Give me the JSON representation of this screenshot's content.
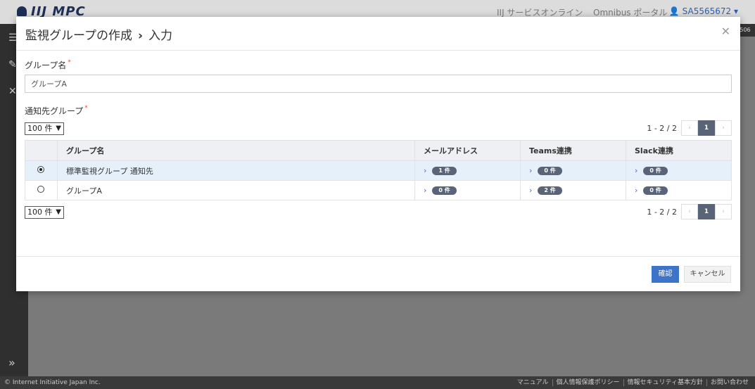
{
  "app": {
    "logo": "IIJ MPC",
    "nav_service": "IIJ サービスオンライン",
    "nav_portal": "Omnibus ポータル",
    "account": "SA5565672",
    "badge_fragment": "506"
  },
  "modal": {
    "title": "監視グループの作成",
    "title_step": "入力",
    "group_name_label": "グループ名",
    "group_name_value": "グループA",
    "notify_label": "通知先グループ",
    "per_page": "100 件",
    "range": "1 - 2 / 2",
    "current_page": "1",
    "columns": [
      "グループ名",
      "メールアドレス",
      "Teams連携",
      "Slack連携"
    ],
    "rows": [
      {
        "name": "標準監視グループ 通知先",
        "email": "1 件",
        "teams": "0 件",
        "slack": "0 件",
        "selected": true
      },
      {
        "name": "グループA",
        "email": "0 件",
        "teams": "2 件",
        "slack": "0 件",
        "selected": false
      }
    ],
    "confirm": "確認",
    "cancel": "キャンセル"
  },
  "footer": {
    "copyright": "© Internet Initiative Japan Inc.",
    "links": [
      "マニュアル",
      "個人情報保護ポリシー",
      "情報セキュリティ基本方針",
      "お問い合わせ"
    ]
  }
}
